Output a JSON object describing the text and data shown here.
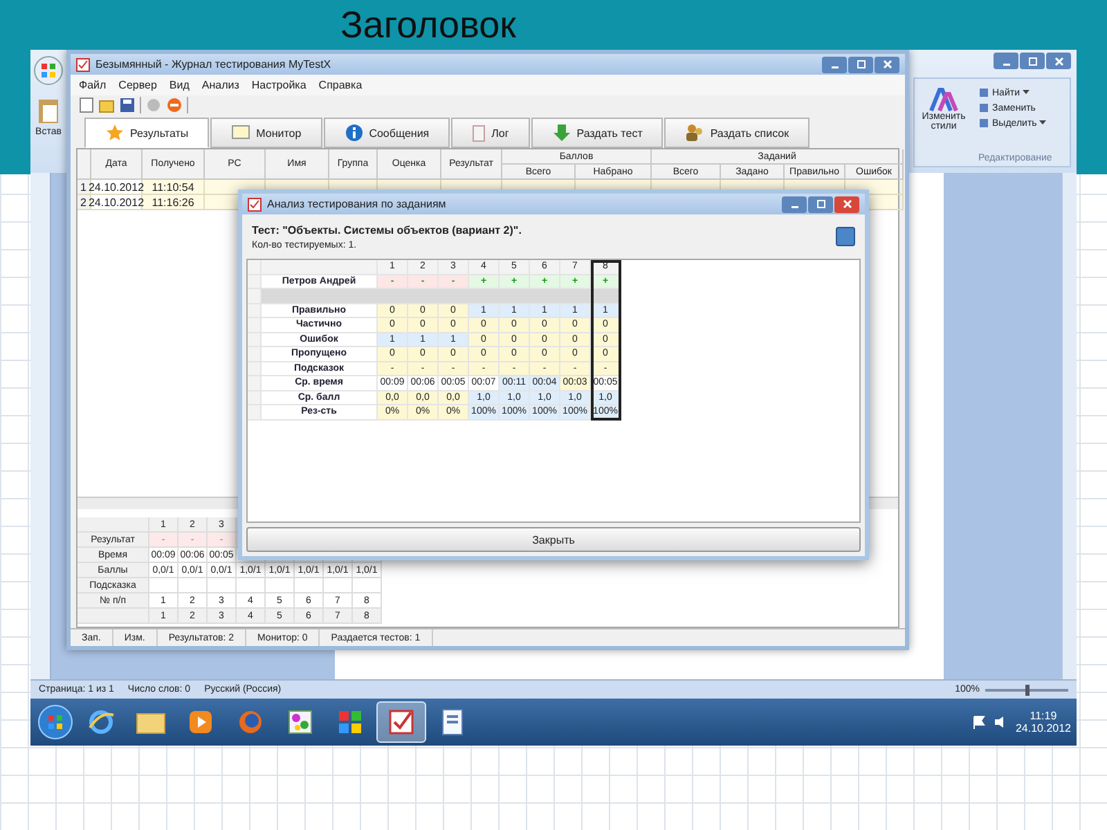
{
  "slide": {
    "title": "Заголовок"
  },
  "word": {
    "ribbon": {
      "paste": "Встав",
      "styles": "Изменить стили",
      "editing": [
        "Найти",
        "Заменить",
        "Выделить"
      ],
      "editing_dropdown": [
        true,
        false,
        true
      ],
      "group": "Редактирование"
    },
    "status_bar": [
      "Страница: 1 из 1",
      "Число слов: 0",
      "Русский (Россия)"
    ],
    "zoom": {
      "reading": "100%",
      "level": 0.5
    }
  },
  "journal": {
    "title": "Безымянный - Журнал тестирования MyTestX",
    "menu": [
      "Файл",
      "Сервер",
      "Вид",
      "Анализ",
      "Настройка",
      "Справка"
    ],
    "tabs": [
      {
        "label": "Результаты",
        "kind": "results",
        "selected": true
      },
      {
        "label": "Монитор",
        "kind": "monitor",
        "selected": false
      },
      {
        "label": "Сообщения",
        "kind": "messages",
        "selected": false
      },
      {
        "label": "Лог",
        "kind": "log",
        "selected": false
      },
      {
        "label": "Раздать тест",
        "kind": "send",
        "selected": false
      },
      {
        "label": "Раздать список",
        "kind": "list",
        "selected": false
      }
    ],
    "table": {
      "columns": [
        "Дата",
        "Получено",
        "PC",
        "Имя",
        "Группа",
        "Оценка",
        "Результат"
      ],
      "groups": [
        {
          "label": "Баллов",
          "columns": [
            "Всего",
            "Набрано"
          ]
        },
        {
          "label": "Заданий",
          "columns": [
            "Всего",
            "Задано",
            "Правильно",
            "Ошибок"
          ]
        }
      ],
      "rows": [
        {
          "number": "1",
          "cells": [
            "24.10.2012",
            "11:10:54"
          ]
        },
        {
          "number": "2",
          "cells": [
            "24.10.2012",
            "11:16:26"
          ]
        }
      ]
    },
    "task_table": {
      "header": [
        "1",
        "2",
        "3"
      ],
      "rows": [
        {
          "label": "Результат",
          "kind": "result",
          "cells": [
            "-",
            "-",
            "-"
          ]
        },
        {
          "label": "Время",
          "kind": "plain",
          "cells": [
            "00:09",
            "00:06",
            "00:05"
          ]
        },
        {
          "label": "Баллы",
          "kind": "plain",
          "cells": [
            "0,0/1",
            "0,0/1",
            "0,0/1",
            "1,0/1",
            "1,0/1",
            "1,0/1",
            "1,0/1",
            "1,0/1"
          ]
        },
        {
          "label": "Подсказка",
          "kind": "plain",
          "cells": []
        },
        {
          "label": "№ п/п",
          "kind": "plain",
          "cells": [
            "1",
            "2",
            "3",
            "4",
            "5",
            "6",
            "7",
            "8"
          ]
        }
      ],
      "footer": [
        "1",
        "2",
        "3",
        "4",
        "5",
        "6",
        "7",
        "8"
      ]
    },
    "status_bar": [
      "Зап.",
      "Изм.",
      "Результатов: 2",
      "Монитор: 0",
      "Раздается тестов: 1"
    ]
  },
  "dialog": {
    "title": "Анализ тестирования по заданиям",
    "test": "Тест: \"Объекты. Системы объектов (вариант 2)\".",
    "count": "Кол-во тестируемых: 1.",
    "columns": [
      {
        "label": "1",
        "selected": false
      },
      {
        "label": "2",
        "selected": false
      },
      {
        "label": "3",
        "selected": false
      },
      {
        "label": "4",
        "selected": false
      },
      {
        "label": "5",
        "selected": false
      },
      {
        "label": "6",
        "selected": false
      },
      {
        "label": "7",
        "selected": false
      },
      {
        "label": "8",
        "selected": true
      }
    ],
    "rows": [
      {
        "label": "Петров Андрей",
        "kind": "person",
        "cells": [
          {
            "text": "-",
            "color": "#fde6e6"
          },
          {
            "text": "-",
            "color": "#fde6e6"
          },
          {
            "text": "-",
            "color": "#fde6e6"
          },
          {
            "text": "+",
            "color": "#e4f8e4"
          },
          {
            "text": "+",
            "color": "#e4f8e4"
          },
          {
            "text": "+",
            "color": "#e4f8e4"
          },
          {
            "text": "+",
            "color": "#e4f8e4"
          },
          {
            "text": "+",
            "color": "#e4f8e4"
          }
        ]
      },
      {
        "kind": "separator"
      },
      {
        "label": "Правильно",
        "kind": "stat",
        "cells": [
          {
            "text": "0",
            "color": "#fdf8d2"
          },
          {
            "text": "0",
            "color": "#fdf8d2"
          },
          {
            "text": "0",
            "color": "#fdf8d2"
          },
          {
            "text": "1",
            "color": "#deedfb"
          },
          {
            "text": "1",
            "color": "#deedfb"
          },
          {
            "text": "1",
            "color": "#deedfb"
          },
          {
            "text": "1",
            "color": "#deedfb"
          },
          {
            "text": "1",
            "color": "#deedfb"
          }
        ]
      },
      {
        "label": "Частично",
        "kind": "stat",
        "cells": [
          {
            "text": "0",
            "color": "#fdf8d2"
          },
          {
            "text": "0",
            "color": "#fdf8d2"
          },
          {
            "text": "0",
            "color": "#fdf8d2"
          },
          {
            "text": "0",
            "color": "#fdf8d2"
          },
          {
            "text": "0",
            "color": "#fdf8d2"
          },
          {
            "text": "0",
            "color": "#fdf8d2"
          },
          {
            "text": "0",
            "color": "#fdf8d2"
          },
          {
            "text": "0",
            "color": "#fdf8d2"
          }
        ]
      },
      {
        "label": "Ошибок",
        "kind": "stat",
        "cells": [
          {
            "text": "1",
            "color": "#deedfb"
          },
          {
            "text": "1",
            "color": "#deedfb"
          },
          {
            "text": "1",
            "color": "#deedfb"
          },
          {
            "text": "0",
            "color": "#fdf8d2"
          },
          {
            "text": "0",
            "color": "#fdf8d2"
          },
          {
            "text": "0",
            "color": "#fdf8d2"
          },
          {
            "text": "0",
            "color": "#fdf8d2"
          },
          {
            "text": "0",
            "color": "#fdf8d2"
          }
        ]
      },
      {
        "label": "Пропущено",
        "kind": "stat",
        "cells": [
          {
            "text": "0",
            "color": "#fdf8d2"
          },
          {
            "text": "0",
            "color": "#fdf8d2"
          },
          {
            "text": "0",
            "color": "#fdf8d2"
          },
          {
            "text": "0",
            "color": "#fdf8d2"
          },
          {
            "text": "0",
            "color": "#fdf8d2"
          },
          {
            "text": "0",
            "color": "#fdf8d2"
          },
          {
            "text": "0",
            "color": "#fdf8d2"
          },
          {
            "text": "0",
            "color": "#fdf8d2"
          }
        ]
      },
      {
        "label": "Подсказок",
        "kind": "stat",
        "cells": [
          {
            "text": "-",
            "color": "#fdf8d2"
          },
          {
            "text": "-",
            "color": "#fdf8d2"
          },
          {
            "text": "-",
            "color": "#fdf8d2"
          },
          {
            "text": "-",
            "color": "#fdf8d2"
          },
          {
            "text": "-",
            "color": "#fdf8d2"
          },
          {
            "text": "-",
            "color": "#fdf8d2"
          },
          {
            "text": "-",
            "color": "#fdf8d2"
          },
          {
            "text": "-",
            "color": "#fdf8d2"
          }
        ]
      },
      {
        "label": "Ср. время",
        "kind": "stat",
        "cells": [
          {
            "text": "00:09",
            "color": "#ffffff"
          },
          {
            "text": "00:06",
            "color": "#ffffff"
          },
          {
            "text": "00:05",
            "color": "#ffffff"
          },
          {
            "text": "00:07",
            "color": "#ffffff"
          },
          {
            "text": "00:11",
            "color": "#deedfb"
          },
          {
            "text": "00:04",
            "color": "#deedfb"
          },
          {
            "text": "00:03",
            "color": "#fdf8d2"
          },
          {
            "text": "00:05",
            "color": "#ffffff"
          }
        ]
      },
      {
        "label": "Ср. балл",
        "kind": "stat",
        "cells": [
          {
            "text": "0,0",
            "color": "#fdf8d2"
          },
          {
            "text": "0,0",
            "color": "#fdf8d2"
          },
          {
            "text": "0,0",
            "color": "#fdf8d2"
          },
          {
            "text": "1,0",
            "color": "#deedfb"
          },
          {
            "text": "1,0",
            "color": "#deedfb"
          },
          {
            "text": "1,0",
            "color": "#deedfb"
          },
          {
            "text": "1,0",
            "color": "#deedfb"
          },
          {
            "text": "1,0",
            "color": "#deedfb"
          }
        ]
      },
      {
        "label": "Рез-сть",
        "kind": "stat",
        "cells": [
          {
            "text": "0%",
            "color": "#fdf8d2"
          },
          {
            "text": "0%",
            "color": "#fdf8d2"
          },
          {
            "text": "0%",
            "color": "#fdf8d2"
          },
          {
            "text": "100%",
            "color": "#deedfb"
          },
          {
            "text": "100%",
            "color": "#deedfb"
          },
          {
            "text": "100%",
            "color": "#deedfb"
          },
          {
            "text": "100%",
            "color": "#deedfb"
          },
          {
            "text": "100%",
            "color": "#deedfb"
          }
        ]
      }
    ],
    "close": "Закрыть"
  },
  "taskbar": {
    "apps": [
      {
        "kind": "browser",
        "selected": false
      },
      {
        "kind": "folder",
        "selected": false
      },
      {
        "kind": "player",
        "selected": false
      },
      {
        "kind": "globe",
        "selected": false
      },
      {
        "kind": "paint",
        "selected": false
      },
      {
        "kind": "tiles",
        "selected": false
      },
      {
        "kind": "tester",
        "selected": true
      },
      {
        "kind": "document",
        "selected": false
      }
    ],
    "time": "11:19",
    "date": "24.10.2012"
  }
}
